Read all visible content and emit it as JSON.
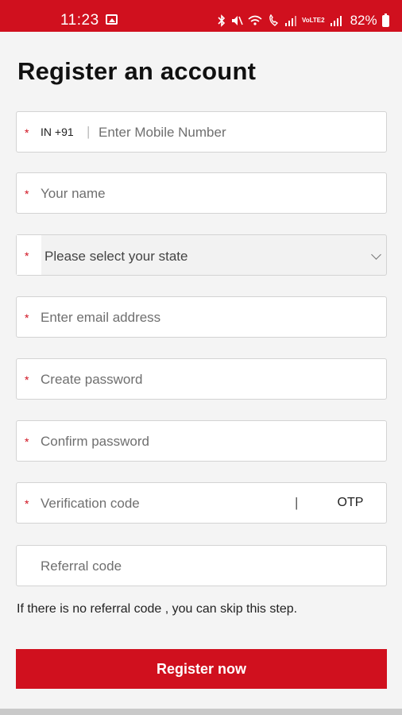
{
  "status_bar": {
    "time": "11:23",
    "battery": "82%",
    "volte": "VoLTE2",
    "icons": [
      "gallery-icon",
      "bluetooth-icon",
      "mute-icon",
      "wifi-calling-icon",
      "signal-icon",
      "battery-icon"
    ]
  },
  "page": {
    "title": "Register an account"
  },
  "form": {
    "mobile": {
      "country_code": "IN +91",
      "separator": "|",
      "placeholder": "Enter Mobile Number",
      "required_mark": "*"
    },
    "name": {
      "placeholder": "Your name",
      "required_mark": "*"
    },
    "state": {
      "placeholder": "Please select your state",
      "required_mark": "*"
    },
    "email": {
      "placeholder": "Enter email address",
      "required_mark": "*"
    },
    "password": {
      "placeholder": "Create password",
      "required_mark": "*"
    },
    "confirm_password": {
      "placeholder": "Confirm password",
      "required_mark": "*"
    },
    "verification": {
      "placeholder": "Verification code",
      "separator": "|",
      "otp_label": "OTP",
      "required_mark": "*"
    },
    "referral": {
      "placeholder": "Referral code"
    },
    "hint": "If there is no referral code , you can skip this step.",
    "submit_label": "Register now"
  },
  "colors": {
    "accent": "#d0101e",
    "background": "#f4f4f4"
  }
}
